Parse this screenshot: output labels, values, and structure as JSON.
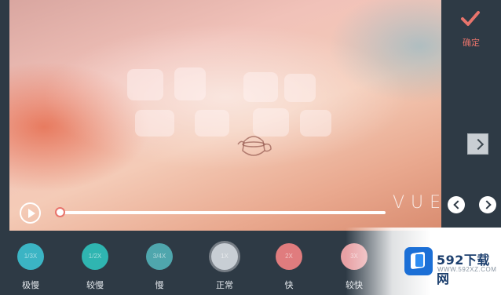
{
  "preview": {
    "watermark": "VUE"
  },
  "playback": {
    "progress": 0.0
  },
  "toolbar": {
    "confirm_label": "确定",
    "confirm_icon": "check-icon",
    "accent": "#e8746c"
  },
  "speeds": [
    {
      "badge": "1/3X",
      "label": "极慢",
      "color": "#3bb4c4",
      "selected": false
    },
    {
      "badge": "1/2X",
      "label": "较慢",
      "color": "#2fb5b1",
      "selected": false
    },
    {
      "badge": "3/4X",
      "label": "慢",
      "color": "#4fa6ad",
      "selected": false
    },
    {
      "badge": "1X",
      "label": "正常",
      "color": "#c8ced4",
      "selected": true
    },
    {
      "badge": "2X",
      "label": "快",
      "color": "#e07c7e",
      "selected": false
    },
    {
      "badge": "3X",
      "label": "较快",
      "color": "#e8a0a4",
      "selected": false
    }
  ],
  "site_watermark": {
    "name": "592下载网",
    "url": "WWW.592XZ.COM"
  }
}
